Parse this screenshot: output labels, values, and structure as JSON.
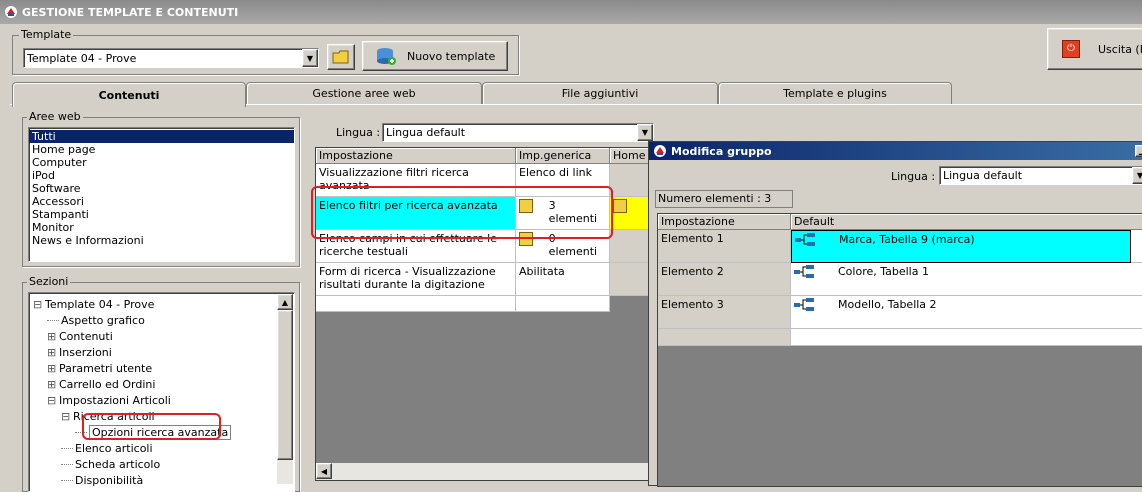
{
  "window": {
    "title": "GESTIONE TEMPLATE E CONTENUTI",
    "app_icon": "app-logo-icon"
  },
  "template_group": {
    "label": "Template",
    "selected": "Template 04 - Prove",
    "new_button": "Nuovo template"
  },
  "exit_button": {
    "label": "Uscita (E"
  },
  "tabs": [
    {
      "label": "Contenuti"
    },
    {
      "label": "Gestione aree web"
    },
    {
      "label": "File aggiuntivi"
    },
    {
      "label": "Template e plugins"
    }
  ],
  "aree_web": {
    "label": "Aree web",
    "items": [
      "Tutti",
      "Home page",
      "Computer",
      "iPod",
      "Software",
      "Accessori",
      "Stampanti",
      "Monitor",
      "News e Informazioni"
    ],
    "selected_index": 0
  },
  "sezioni": {
    "label": "Sezioni",
    "tree": [
      {
        "text": "Template 04 - Prove",
        "expander": "⊟"
      },
      {
        "text": "Aspetto grafico",
        "expander": ""
      },
      {
        "text": "Contenuti",
        "expander": "⊞"
      },
      {
        "text": "Inserzioni",
        "expander": "⊞"
      },
      {
        "text": "Parametri utente",
        "expander": "⊞"
      },
      {
        "text": "Carrello ed Ordini",
        "expander": "⊞"
      },
      {
        "text": "Impostazioni Articoli",
        "expander": "⊟"
      },
      {
        "text": "Ricerca articoli",
        "expander": "⊟"
      },
      {
        "text": "Opzioni ricerca avanzata",
        "expander": ""
      },
      {
        "text": "Elenco articoli",
        "expander": ""
      },
      {
        "text": "Scheda articolo",
        "expander": ""
      },
      {
        "text": "Disponibilità",
        "expander": ""
      }
    ]
  },
  "lingua": {
    "label": "Lingua :",
    "value": "Lingua default"
  },
  "main_grid": {
    "headers": [
      "Impostazione",
      "Imp.generica",
      "Home p"
    ],
    "rows": [
      {
        "name": "Visualizzazione filtri ricerca avanzata",
        "value": "Elenco di link"
      },
      {
        "name": "Elenco filtri per ricerca avanzata",
        "value": "3 elementi"
      },
      {
        "name": "Elenco campi in cui effettuare le ricerche testuali",
        "value": "0 elementi"
      },
      {
        "name": "Form di ricerca - Visualizzazione risultati durante la digitazione",
        "value": "Abilitata"
      }
    ]
  },
  "dialog": {
    "title": "Modifica gruppo",
    "lingua_label": "Lingua :",
    "lingua_value": "Lingua default",
    "count_label": "Numero elementi : 3",
    "headers": [
      "Impostazione",
      "Default"
    ],
    "rows": [
      {
        "name": "Elemento 1",
        "value": "Marca, Tabella 9 (marca)"
      },
      {
        "name": "Elemento 2",
        "value": "Colore, Tabella 1"
      },
      {
        "name": "Elemento 3",
        "value": "Modello, Tabella 2"
      }
    ]
  },
  "colors": {
    "highlight_cyan": "#00ffff",
    "highlight_yellow": "#ffff00",
    "annotation_red": "#e02020",
    "selection_blue": "#0a246a"
  }
}
